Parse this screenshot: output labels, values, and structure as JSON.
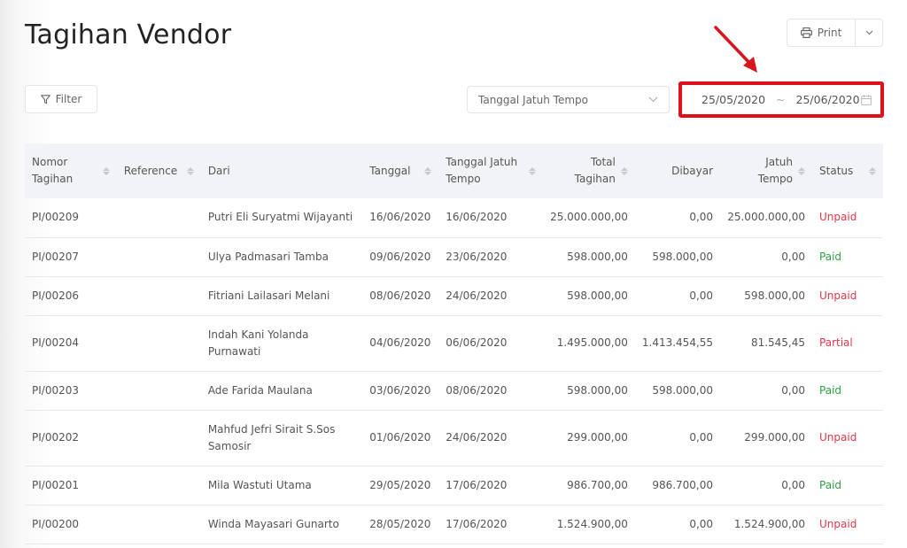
{
  "page": {
    "title": "Tagihan Vendor"
  },
  "toolbar": {
    "print_label": "Print",
    "print_icon": "printer-icon",
    "print_menu_icon": "chevron-down-icon",
    "filter_label": "Filter",
    "filter_icon": "funnel-icon",
    "date_type": "Tanggal Jatuh Tempo",
    "date_type_icon": "chevron-down-icon",
    "date_from": "25/05/2020",
    "date_separator": "~",
    "date_to": "25/06/2020",
    "calendar_icon": "calendar-icon"
  },
  "annotation": {
    "color": "#e0101a",
    "type": "red arrow pointing to highlighted date range"
  },
  "table": {
    "headers": {
      "nomor_tagihan": [
        "Nomor",
        "Tagihan"
      ],
      "reference": "Reference",
      "dari": "Dari",
      "tanggal": "Tanggal",
      "tanggal_jatuh_tempo": [
        "Tanggal Jatuh",
        "Tempo"
      ],
      "total_tagihan": [
        "Total",
        "Tagihan"
      ],
      "dibayar": "Dibayar",
      "jatuh_tempo": [
        "Jatuh",
        "Tempo"
      ],
      "status": "Status"
    },
    "rows": [
      {
        "nomor": "PI/00209",
        "reference": "",
        "dari": [
          "Putri Eli Suryatmi Wijayanti"
        ],
        "tanggal": "16/06/2020",
        "jatuh_tempo_date": "16/06/2020",
        "total": "25.000.000,00",
        "dibayar": "0,00",
        "sisa": "25.000.000,00",
        "status": "Unpaid"
      },
      {
        "nomor": "PI/00207",
        "reference": "",
        "dari": [
          "Ulya Padmasari Tamba"
        ],
        "tanggal": "09/06/2020",
        "jatuh_tempo_date": "23/06/2020",
        "total": "598.000,00",
        "dibayar": "598.000,00",
        "sisa": "0,00",
        "status": "Paid"
      },
      {
        "nomor": "PI/00206",
        "reference": "",
        "dari": [
          "Fitriani Lailasari Melani"
        ],
        "tanggal": "08/06/2020",
        "jatuh_tempo_date": "24/06/2020",
        "total": "598.000,00",
        "dibayar": "0,00",
        "sisa": "598.000,00",
        "status": "Unpaid"
      },
      {
        "nomor": "PI/00204",
        "reference": "",
        "dari": [
          "Indah Kani Yolanda",
          "Purnawati"
        ],
        "tanggal": "04/06/2020",
        "jatuh_tempo_date": "06/06/2020",
        "total": "1.495.000,00",
        "dibayar": "1.413.454,55",
        "sisa": "81.545,45",
        "status": "Partial"
      },
      {
        "nomor": "PI/00203",
        "reference": "",
        "dari": [
          "Ade Farida Maulana"
        ],
        "tanggal": "03/06/2020",
        "jatuh_tempo_date": "08/06/2020",
        "total": "598.000,00",
        "dibayar": "598.000,00",
        "sisa": "0,00",
        "status": "Paid"
      },
      {
        "nomor": "PI/00202",
        "reference": "",
        "dari": [
          "Mahfud Jefri Sirait S.Sos",
          "Samosir"
        ],
        "tanggal": "01/06/2020",
        "jatuh_tempo_date": "24/06/2020",
        "total": "299.000,00",
        "dibayar": "0,00",
        "sisa": "299.000,00",
        "status": "Unpaid"
      },
      {
        "nomor": "PI/00201",
        "reference": "",
        "dari": [
          "Mila Wastuti Utama"
        ],
        "tanggal": "29/05/2020",
        "jatuh_tempo_date": "17/06/2020",
        "total": "986.700,00",
        "dibayar": "986.700,00",
        "sisa": "0,00",
        "status": "Paid"
      },
      {
        "nomor": "PI/00200",
        "reference": "",
        "dari": [
          "Winda Mayasari Gunarto"
        ],
        "tanggal": "28/05/2020",
        "jatuh_tempo_date": "17/06/2020",
        "total": "1.524.900,00",
        "dibayar": "0,00",
        "sisa": "1.524.900,00",
        "status": "Unpaid"
      }
    ]
  },
  "status_colors": {
    "Unpaid": "#e0394a",
    "Partial": "#e0394a",
    "Paid": "#2ea043"
  }
}
